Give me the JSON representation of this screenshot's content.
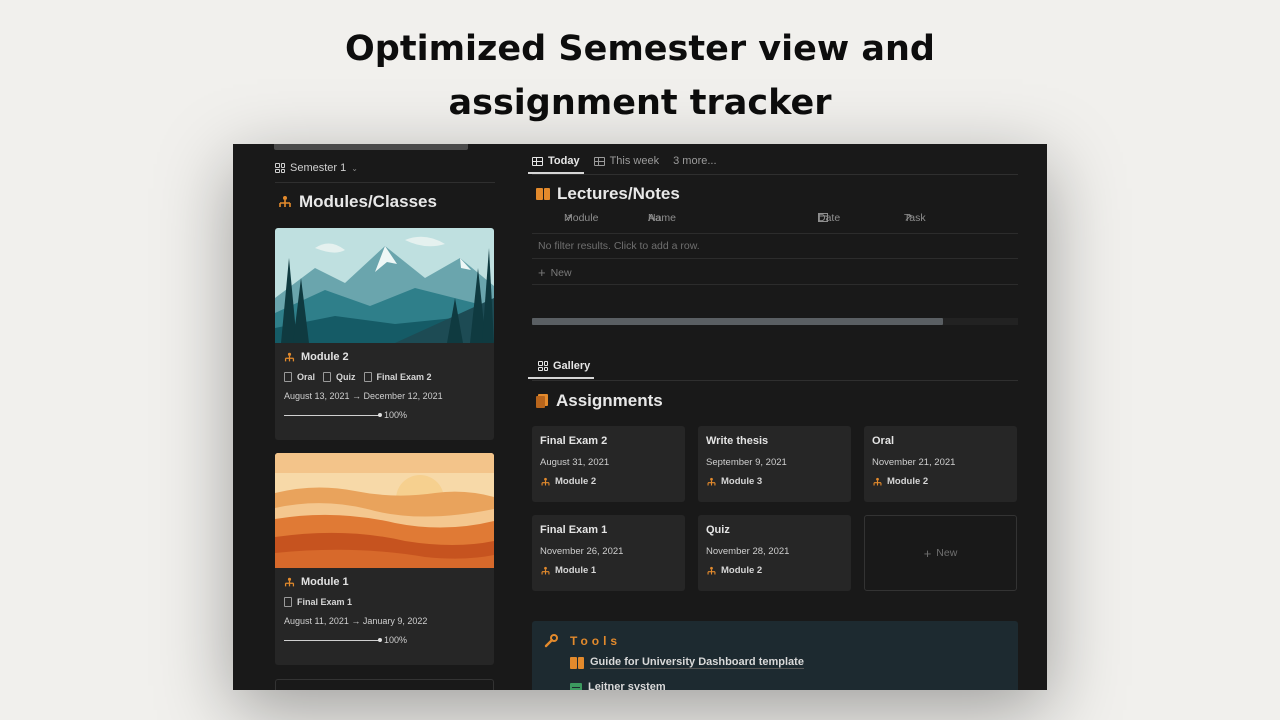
{
  "headline": {
    "line1": "Optimized Semester view and",
    "line2": "assignment tracker"
  },
  "left": {
    "semester_tab": "Semester 1",
    "modules_heading": "Modules/Classes",
    "cards": [
      {
        "title": "Module 2",
        "tags": [
          "Oral",
          "Quiz",
          "Final Exam 2"
        ],
        "dates": "August 13, 2021 → December 12, 2021",
        "progress": 1.0,
        "progress_label": "100%"
      },
      {
        "title": "Module 1",
        "tags": [
          "Final Exam 1"
        ],
        "dates": "August 11, 2021 → January 9, 2022",
        "progress": 1.0,
        "progress_label": "100%"
      }
    ]
  },
  "right": {
    "tabs": [
      {
        "label": "Today",
        "active": true
      },
      {
        "label": "This week",
        "active": false
      },
      {
        "label": "3 more...",
        "active": false
      }
    ],
    "lectures": {
      "heading": "Lectures/Notes",
      "columns": [
        "Module",
        "Name",
        "Date",
        "Task"
      ],
      "column_prefixes": [
        "↗",
        "Aa",
        "",
        "↗"
      ],
      "empty_text": "No filter results. Click to add a row.",
      "new_label": "New"
    },
    "gallery_tab": "Gallery",
    "assignments": {
      "heading": "Assignments",
      "cards": [
        {
          "name": "Final Exam 2",
          "date": "August 31, 2021",
          "module": "Module 2"
        },
        {
          "name": "Write thesis",
          "date": "September 9, 2021",
          "module": "Module 3"
        },
        {
          "name": "Oral",
          "date": "November 21, 2021",
          "module": "Module 2"
        },
        {
          "name": "Final Exam 1",
          "date": "November 26, 2021",
          "module": "Module 1"
        },
        {
          "name": "Quiz",
          "date": "November 28, 2021",
          "module": "Module 2"
        }
      ],
      "new_label": "New"
    },
    "tools": {
      "heading": "Tools",
      "items": [
        "Guide for University Dashboard template",
        "Leitner system"
      ]
    }
  },
  "colors": {
    "accent_orange": "#e38a2c",
    "app_bg": "#191919",
    "card_bg": "#262626",
    "tools_bg": "#1d2a30"
  }
}
